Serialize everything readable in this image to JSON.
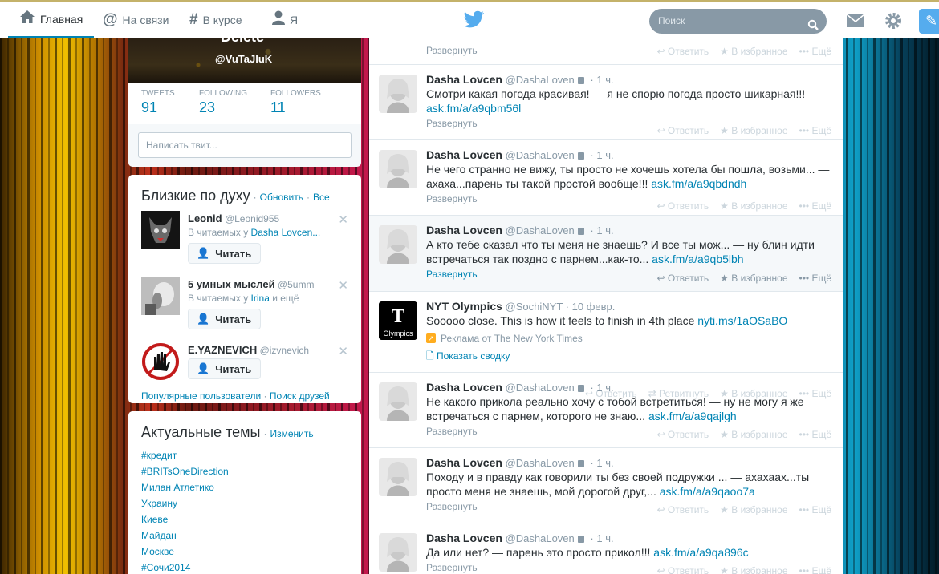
{
  "nav": {
    "home": "Главная",
    "connect": "На связи",
    "discover": "В курсе",
    "me": "Я"
  },
  "search": {
    "placeholder": "Поиск"
  },
  "profile": {
    "name": "Delete",
    "handle": "@VuTaJluK",
    "tweets_label": "TWEETS",
    "tweets": "91",
    "following_label": "FOLLOWING",
    "following": "23",
    "followers_label": "FOLLOWERS",
    "followers": "11",
    "compose_placeholder": "Написать твит..."
  },
  "wtf": {
    "title": "Близкие по духу",
    "refresh": "Обновить",
    "all": "Все",
    "follow_label": "Читать",
    "items": [
      {
        "name": "Leonid",
        "screen": "@Leonid955",
        "via_prefix": "В читаемых у ",
        "via_link": "Dasha Lovcen...",
        "via_suffix": ""
      },
      {
        "name": "5 умных мыслей",
        "screen": "@5umm",
        "via_prefix": "В читаемых у ",
        "via_link": "Irina",
        "via_suffix": " и ещё"
      },
      {
        "name": "E.YAZNEVICH",
        "screen": "@izvnevich",
        "via_prefix": "",
        "via_link": "",
        "via_suffix": ""
      }
    ],
    "popular": "Популярные пользователи",
    "find_friends": "Поиск друзей"
  },
  "trends": {
    "title": "Актуальные темы",
    "change": "Изменить",
    "items": [
      "#кредит",
      "#BRITsOneDirection",
      "Милан Атлетико",
      "Украину",
      "Киеве",
      "Майдан",
      "Москве",
      "#Сочи2014"
    ]
  },
  "actions": {
    "reply": "Ответить",
    "retweet": "Ретвитнуть",
    "favorite": "В избранное",
    "more": "Ещё",
    "expand": "Развернуть",
    "summary": "Показать сводку"
  },
  "tweets": [
    {
      "name": "Dasha Lovcen",
      "screen": "@DashaLoven",
      "time": "1 ч.",
      "text": "Смотри какая погода красивая! — я не спорю погода просто шикарная!!! ",
      "link": "ask.fm/a/a9qbm56l"
    },
    {
      "name": "Dasha Lovcen",
      "screen": "@DashaLoven",
      "time": "1 ч.",
      "text": "Не чего странно не вижу, ты просто не хочешь хотела бы пошла, возьми... — ахаха...парень ты такой простой вообще!!! ",
      "link": "ask.fm/a/a9qbdndh"
    },
    {
      "name": "Dasha Lovcen",
      "screen": "@DashaLoven",
      "time": "1 ч.",
      "text": "А кто тебе сказал что ты меня не знаешь? И все ты мож... — ну блин идти встречаться так поздно с парнем...как-то... ",
      "link": "ask.fm/a/a9qb5lbh"
    },
    {
      "name": "NYT Olympics",
      "screen": "@SochiNYT",
      "time": "10 февр.",
      "text": "Sooooo close. This is how it feels to finish in 4th place ",
      "link": "nyti.ms/1aOSaBO",
      "promo": "Реклама от The New York Times",
      "avatar_text": "Olympics"
    },
    {
      "name": "Dasha Lovcen",
      "screen": "@DashaLoven",
      "time": "1 ч.",
      "text": "Не какого прикола реально хочу с тобой встретиться! — ну не могу я же встречаться с парнем, которого не знаю... ",
      "link": "ask.fm/a/a9qajlgh"
    },
    {
      "name": "Dasha Lovcen",
      "screen": "@DashaLoven",
      "time": "1 ч.",
      "text": "Походу и в правду как говорили ты без своей подружки ... — ахахаах...ты просто меня не знаешь, мой дорогой друг,... ",
      "link": "ask.fm/a/a9qaoo7a"
    },
    {
      "name": "Dasha Lovcen",
      "screen": "@DashaLoven",
      "time": "1 ч.",
      "text": "Да или нет? — парень это просто прикол!!! ",
      "link": "ask.fm/a/a9qa896c"
    }
  ],
  "colors": {
    "link": "#0084b4",
    "accent": "#55acee"
  }
}
